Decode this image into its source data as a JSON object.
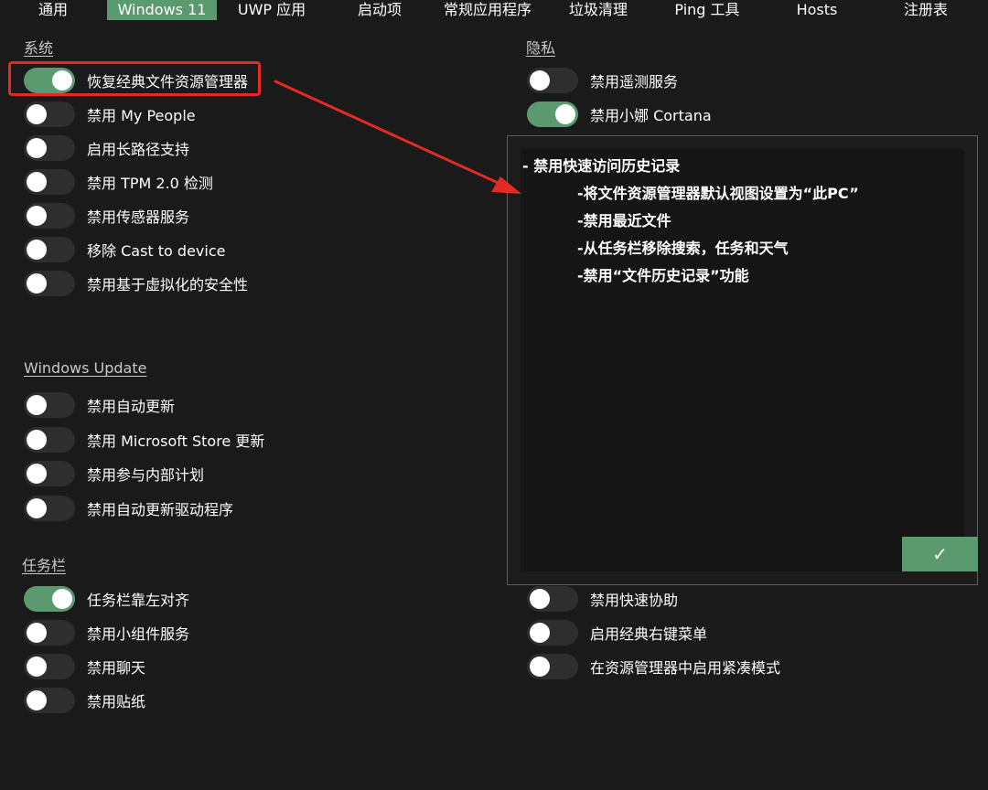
{
  "tabs": [
    {
      "label": "通用",
      "active": false
    },
    {
      "label": "Windows 11",
      "active": true
    },
    {
      "label": "UWP 应用",
      "active": false
    },
    {
      "label": "启动项",
      "active": false
    },
    {
      "label": "常规应用程序",
      "active": false
    },
    {
      "label": "垃圾清理",
      "active": false
    },
    {
      "label": "Ping 工具",
      "active": false
    },
    {
      "label": "Hosts",
      "active": false
    },
    {
      "label": "注册表",
      "active": false
    }
  ],
  "system": {
    "title": "系统",
    "items": [
      {
        "label": "恢复经典文件资源管理器",
        "on": true
      },
      {
        "label": "禁用 My People",
        "on": false
      },
      {
        "label": "启用长路径支持",
        "on": false
      },
      {
        "label": "禁用 TPM 2.0 检测",
        "on": false
      },
      {
        "label": "禁用传感器服务",
        "on": false
      },
      {
        "label": "移除 Cast to device",
        "on": false
      },
      {
        "label": "禁用基于虚拟化的安全性",
        "on": false
      }
    ]
  },
  "windows_update": {
    "title": "Windows Update",
    "items": [
      {
        "label": "禁用自动更新",
        "on": false
      },
      {
        "label": "禁用 Microsoft Store 更新",
        "on": false
      },
      {
        "label": "禁用参与内部计划",
        "on": false
      },
      {
        "label": "禁用自动更新驱动程序",
        "on": false
      }
    ]
  },
  "taskbar": {
    "title": "任务栏",
    "items": [
      {
        "label": "任务栏靠左对齐",
        "on": true
      },
      {
        "label": "禁用小组件服务",
        "on": false
      },
      {
        "label": "禁用聊天",
        "on": false
      },
      {
        "label": "禁用贴纸",
        "on": false
      }
    ]
  },
  "privacy": {
    "title": "隐私",
    "items": [
      {
        "label": "禁用遥测服务",
        "on": false
      },
      {
        "label": "禁用小娜 Cortana",
        "on": true
      }
    ]
  },
  "right_lower": {
    "items": [
      {
        "label": "禁用快速协助",
        "on": false
      },
      {
        "label": "启用经典右键菜单",
        "on": false
      },
      {
        "label": "在资源管理器中启用紧凑模式",
        "on": false
      }
    ]
  },
  "popup": {
    "heading": "- 禁用快速访问历史记录",
    "lines": [
      "-将文件资源管理器默认视图设置为“此PC”",
      "-禁用最近文件",
      "-从任务栏移除搜索，任务和天气",
      "-禁用“文件历史记录”功能"
    ],
    "ok_label": "✓"
  },
  "colors": {
    "accent_green": "#5a9a6e",
    "background": "#1a1a1a",
    "highlight_red": "#e32b22"
  }
}
